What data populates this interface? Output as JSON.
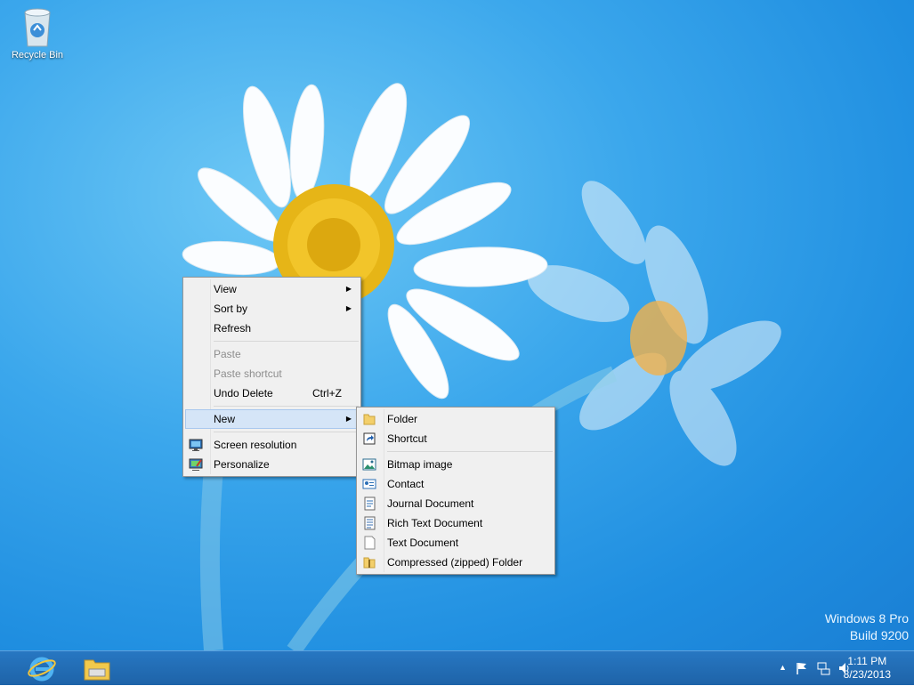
{
  "desktop": {
    "icons": [
      {
        "label": "Recycle Bin",
        "icon": "recycle-bin-icon"
      }
    ],
    "watermark": {
      "line1": "Windows 8 Pro",
      "line2": "Build 9200"
    }
  },
  "context_menu": {
    "items": [
      {
        "label": "View",
        "submenu": true
      },
      {
        "label": "Sort by",
        "submenu": true
      },
      {
        "label": "Refresh"
      },
      {
        "label": "Paste",
        "disabled": true
      },
      {
        "label": "Paste shortcut",
        "disabled": true
      },
      {
        "label": "Undo Delete",
        "shortcut": "Ctrl+Z"
      },
      {
        "label": "New",
        "submenu": true,
        "highlighted": true
      },
      {
        "label": "Screen resolution",
        "icon": "monitor-icon"
      },
      {
        "label": "Personalize",
        "icon": "personalize-icon"
      }
    ]
  },
  "new_submenu": {
    "items": [
      {
        "label": "Folder",
        "icon": "folder-icon"
      },
      {
        "label": "Shortcut",
        "icon": "shortcut-icon"
      },
      {
        "label": "Bitmap image",
        "icon": "bitmap-icon"
      },
      {
        "label": "Contact",
        "icon": "contact-icon"
      },
      {
        "label": "Journal Document",
        "icon": "journal-icon"
      },
      {
        "label": "Rich Text Document",
        "icon": "rich-text-icon"
      },
      {
        "label": "Text Document",
        "icon": "text-document-icon"
      },
      {
        "label": "Compressed (zipped) Folder",
        "icon": "zip-folder-icon"
      }
    ]
  },
  "taskbar": {
    "pinned": [
      {
        "icon": "internet-explorer-icon"
      },
      {
        "icon": "file-explorer-icon"
      }
    ],
    "tray_icons": [
      "show-hidden-icons-icon",
      "action-center-flag-icon",
      "network-icon",
      "volume-icon"
    ],
    "clock": {
      "time": "1:11 PM",
      "date": "8/23/2013"
    }
  },
  "colors": {
    "desktop": "#2a9ae6",
    "taskbar": "#2270b8",
    "menu_bg": "#f0f0f0",
    "menu_highlight": "#d5e5f7"
  }
}
